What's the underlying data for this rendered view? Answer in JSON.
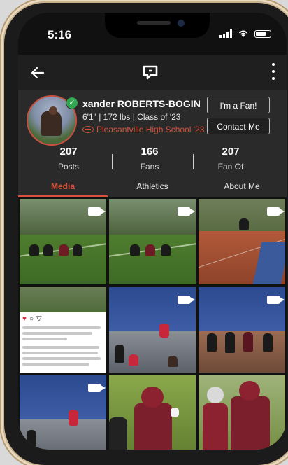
{
  "status_bar": {
    "time": "5:16"
  },
  "app_bar": {
    "back_icon": "arrow-left-icon",
    "logo_icon": "chat-logo-icon",
    "menu_icon": "more-vertical-icon"
  },
  "profile": {
    "name": "xander ROBERTS-BOGIN",
    "stats": "6'1\" | 172 lbs | Class of '23",
    "school": "Pleasantville High School '23",
    "verified": true,
    "buttons": {
      "fan": "I'm a Fan!",
      "contact": "Contact Me"
    }
  },
  "counts": [
    {
      "value": "207",
      "label": "Posts"
    },
    {
      "value": "166",
      "label": "Fans"
    },
    {
      "value": "207",
      "label": "Fan Of"
    }
  ],
  "tabs": [
    {
      "label": "Media",
      "active": true
    },
    {
      "label": "Athletics",
      "active": false
    },
    {
      "label": "About Me",
      "active": false
    }
  ],
  "colors": {
    "accent": "#d8513d",
    "background": "#1f1f1f",
    "panel": "#2a2a2a"
  }
}
